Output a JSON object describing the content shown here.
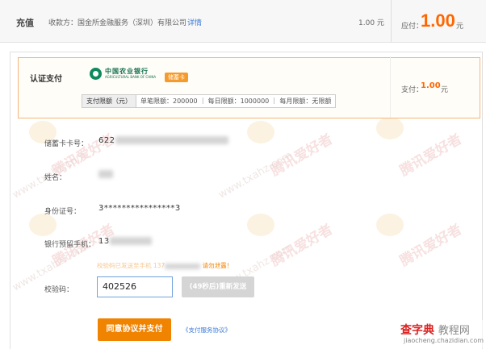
{
  "header": {
    "title": "充值",
    "payee": "收款方：国金所金融服务（深圳）有限公司",
    "detail_link": "详情",
    "amount_text": "1.00 元",
    "due_label": "应付：",
    "due_amount": "1.00",
    "due_unit": "元"
  },
  "auth": {
    "label": "认证支付",
    "bank_name_cn": "中国农业银行",
    "bank_name_en": "AGRICULTURAL BANK OF CHINA",
    "card_type_badge": "储蓄卡",
    "limits_header": "支付限额（元）",
    "limits_text": "单笔限额：200000 ｜ 每日限额：1000000 ｜ 每月限额：无限额"
  },
  "payment_side": {
    "label": "支付：",
    "amount": "1.00",
    "unit": "元"
  },
  "form": {
    "card_label": "储蓄卡卡号：",
    "card_value": "622",
    "name_label": "姓名：",
    "id_label": "身份证号：",
    "id_value": "3****************3",
    "phone_label": "银行预留手机：",
    "phone_value": "13",
    "hint_text": "校验码已发送至手机",
    "hint_phone": "137",
    "hint_warn": "请勿泄露！",
    "code_label": "校验码：",
    "code_value": "402526",
    "resend_label": "(49秒后)重新发送",
    "agree_button": "同意协议并支付",
    "protocol_link": "《支付服务协议》"
  },
  "watermark": {
    "text": "腾讯爱好者",
    "url": "www.txahz.com"
  },
  "site_stamp": {
    "brand": "查字典",
    "section": "教程网",
    "url": "jiaocheng.chazidian.com"
  },
  "colors": {
    "accent": "#ff6600",
    "button": "#f08300",
    "link": "#3a7bd5",
    "auth_border": "#f5b57a"
  }
}
